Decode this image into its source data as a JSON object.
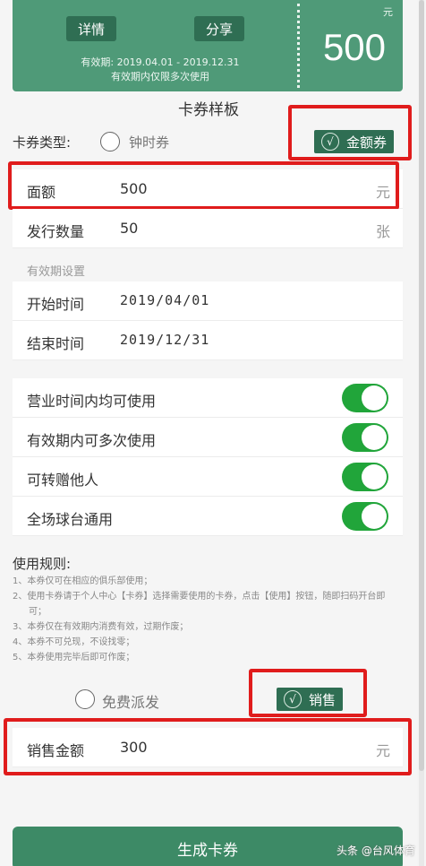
{
  "ticket": {
    "detail_label": "详情",
    "share_label": "分享",
    "validity_line1": "有效期: 2019.04.01 - 2019.12.31",
    "validity_line2": "有效期内仅限多次使用",
    "unit": "元",
    "amount": "500"
  },
  "template_title": "卡券样板",
  "card_type": {
    "label": "卡券类型:",
    "option_hourly": "钟时券",
    "option_amount": "金额券",
    "check_mark": "√"
  },
  "face_value": {
    "label": "面额",
    "value": "500",
    "suffix": "元"
  },
  "issue_count": {
    "label": "发行数量",
    "value": "50",
    "suffix": "张"
  },
  "validity_section": {
    "title": "有效期设置",
    "start_label": "开始时间",
    "start_value": "2019/04/01",
    "end_label": "结束时间",
    "end_value": "2019/12/31"
  },
  "toggles": [
    {
      "label": "营业时间内均可使用",
      "on": true
    },
    {
      "label": "有效期内可多次使用",
      "on": true
    },
    {
      "label": "可转赠他人",
      "on": true
    },
    {
      "label": "全场球台通用",
      "on": true
    }
  ],
  "rules": {
    "title": "使用规则:",
    "items": [
      "1、本券仅可在相应的俱乐部使用；",
      "2、使用卡券请于个人中心【卡券】选择需要使用的卡券，点击【使用】按钮，随即扫码开台即可；",
      "3、本券仅在有效期内消费有效，过期作废；",
      "4、本券不可兑现，不设找零；",
      "5、本券使用完毕后即可作废；"
    ]
  },
  "distribution": {
    "option_free": "免费派发",
    "option_sale": "销售",
    "check_mark": "√"
  },
  "sale_amount": {
    "label": "销售金额",
    "value": "300",
    "suffix": "元"
  },
  "generate_label": "生成卡券",
  "watermark": "头条 @台风体育",
  "colors": {
    "primary": "#4f9a78",
    "primary_dark": "#2f6e53",
    "toggle_on": "#21a53a",
    "highlight": "#e01c1c"
  }
}
